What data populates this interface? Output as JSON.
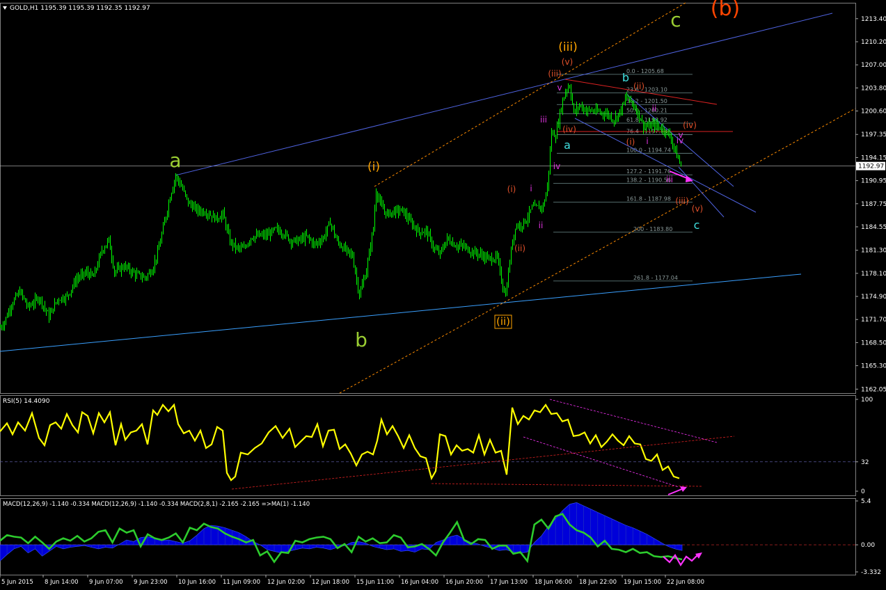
{
  "window_title": "GOLD,H1  1195.39 1195.39 1192.35 1192.97",
  "price_axis": {
    "ticks": [
      "1213.40",
      "1210.20",
      "1207.00",
      "1203.80",
      "1200.60",
      "1197.35",
      "1194.15",
      "1190.95",
      "1187.75",
      "1184.55",
      "1181.30",
      "1178.10",
      "1174.90",
      "1171.70",
      "1168.50",
      "1165.30",
      "1162.05"
    ],
    "current_price": "1192.97",
    "colors": {
      "grid": "#1a1a1a",
      "border": "#808080",
      "current": "#c0c0c0"
    }
  },
  "time_axis": {
    "ticks": [
      "5 Jun 2015",
      "8 Jun 14:00",
      "9 Jun 07:00",
      "9 Jun 23:00",
      "10 Jun 16:00",
      "11 Jun 09:00",
      "12 Jun 02:00",
      "12 Jun 18:00",
      "15 Jun 11:00",
      "16 Jun 04:00",
      "16 Jun 20:00",
      "17 Jun 13:00",
      "18 Jun 06:00",
      "18 Jun 22:00",
      "19 Jun 15:00",
      "22 Jun 08:00"
    ]
  },
  "chart_data": [
    {
      "type": "candlestick",
      "title": "GOLD,H1  1195.39 1195.39 1192.35 1192.97",
      "ylim": [
        1161.5,
        1215.6
      ],
      "candle_color": "#00ff00",
      "close_path": [
        [
          0,
          1170.6
        ],
        [
          6,
          1171.4
        ],
        [
          16,
          1173.8
        ],
        [
          28,
          1175.6
        ],
        [
          40,
          1173.4
        ],
        [
          56,
          1174.8
        ],
        [
          70,
          1172.1
        ],
        [
          82,
          1174.5
        ],
        [
          96,
          1174.9
        ],
        [
          110,
          1177.4
        ],
        [
          124,
          1178.2
        ],
        [
          134,
          1177.6
        ],
        [
          146,
          1181.3
        ],
        [
          156,
          1182.7
        ],
        [
          164,
          1178.3
        ],
        [
          178,
          1179.1
        ],
        [
          194,
          1178.0
        ],
        [
          208,
          1177.5
        ],
        [
          218,
          1178.6
        ],
        [
          226,
          1180.9
        ],
        [
          236,
          1185.2
        ],
        [
          244,
          1188.8
        ],
        [
          252,
          1191.6
        ],
        [
          260,
          1190.2
        ],
        [
          270,
          1187.9
        ],
        [
          282,
          1186.9
        ],
        [
          296,
          1186.6
        ],
        [
          310,
          1185.7
        ],
        [
          320,
          1186.3
        ],
        [
          330,
          1182.5
        ],
        [
          340,
          1181.6
        ],
        [
          350,
          1181.5
        ],
        [
          360,
          1183.1
        ],
        [
          372,
          1183.3
        ],
        [
          384,
          1183.4
        ],
        [
          396,
          1184.2
        ],
        [
          408,
          1183.6
        ],
        [
          418,
          1182.6
        ],
        [
          428,
          1182.6
        ],
        [
          440,
          1183.2
        ],
        [
          452,
          1182.1
        ],
        [
          464,
          1183.0
        ],
        [
          474,
          1185.2
        ],
        [
          484,
          1182.5
        ],
        [
          494,
          1181.5
        ],
        [
          506,
          1180.5
        ],
        [
          516,
          1175.1
        ],
        [
          526,
          1178.5
        ],
        [
          536,
          1184.4
        ],
        [
          540,
          1189.6
        ],
        [
          548,
          1187.2
        ],
        [
          556,
          1186.3
        ],
        [
          566,
          1186.7
        ],
        [
          578,
          1186.8
        ],
        [
          590,
          1185.1
        ],
        [
          602,
          1183.8
        ],
        [
          612,
          1184.0
        ],
        [
          624,
          1181.4
        ],
        [
          632,
          1180.8
        ],
        [
          642,
          1182.9
        ],
        [
          654,
          1182.0
        ],
        [
          666,
          1181.8
        ],
        [
          678,
          1181.1
        ],
        [
          690,
          1180.7
        ],
        [
          702,
          1180.1
        ],
        [
          714,
          1180.3
        ],
        [
          720,
          1177.1
        ],
        [
          726,
          1175.1
        ],
        [
          734,
          1181.3
        ],
        [
          740,
          1184.7
        ],
        [
          748,
          1184.8
        ],
        [
          756,
          1185.6
        ],
        [
          764,
          1187.2
        ],
        [
          772,
          1187.2
        ],
        [
          780,
          1187.4
        ],
        [
          786,
          1190.0
        ],
        [
          792,
          1197.6
        ],
        [
          798,
          1197.2
        ],
        [
          806,
          1201.2
        ],
        [
          812,
          1203.4
        ],
        [
          818,
          1204.2
        ],
        [
          824,
          1200.3
        ],
        [
          832,
          1201.4
        ],
        [
          842,
          1200.7
        ],
        [
          852,
          1200.6
        ],
        [
          862,
          1200.4
        ],
        [
          872,
          1200.2
        ],
        [
          882,
          1199.4
        ],
        [
          892,
          1200.8
        ],
        [
          900,
          1202.6
        ],
        [
          908,
          1201.7
        ],
        [
          916,
          1200.4
        ],
        [
          924,
          1198.6
        ],
        [
          932,
          1198.4
        ],
        [
          940,
          1198.7
        ],
        [
          948,
          1198.3
        ],
        [
          956,
          1197.9
        ],
        [
          964,
          1196.8
        ],
        [
          972,
          1194.4
        ],
        [
          978,
          1193.0
        ]
      ],
      "wave_labels": [
        {
          "text": "a",
          "color": "#9acd32"
        },
        {
          "text": "b",
          "color": "#9acd32"
        },
        {
          "text": "c",
          "color": "#9acd32"
        },
        {
          "text": "(b)",
          "color": "#ff4500"
        },
        {
          "text": "(i)",
          "color": "#ffa500"
        },
        {
          "text": "(ii)",
          "color": "#ffa500"
        },
        {
          "text": "(iii)",
          "color": "#ffa500"
        },
        {
          "text": "(i)",
          "color": "#e0502a"
        },
        {
          "text": "(ii)",
          "color": "#e0502a"
        },
        {
          "text": "(iii)",
          "color": "#e0502a"
        },
        {
          "text": "(iv)",
          "color": "#e0502a"
        },
        {
          "text": "(v)",
          "color": "#e0502a"
        },
        {
          "text": "i",
          "color": "#dd33dd"
        },
        {
          "text": "ii",
          "color": "#dd33dd"
        },
        {
          "text": "iii",
          "color": "#dd33dd"
        },
        {
          "text": "iv",
          "color": "#dd33dd"
        },
        {
          "text": "v",
          "color": "#dd33dd"
        },
        {
          "text": "a",
          "color": "#40e0e0"
        },
        {
          "text": "b",
          "color": "#40e0e0"
        },
        {
          "text": "c",
          "color": "#40e0e0"
        },
        {
          "text": "(i)",
          "color": "#e0502a"
        },
        {
          "text": "(ii)",
          "color": "#e0502a"
        },
        {
          "text": "(iii)",
          "color": "#e0502a"
        },
        {
          "text": "(iv)",
          "color": "#e0502a"
        },
        {
          "text": "(v)",
          "color": "#e0502a"
        },
        {
          "text": "i",
          "color": "#dd33dd"
        },
        {
          "text": "ii",
          "color": "#dd33dd"
        },
        {
          "text": "iii",
          "color": "#dd33dd"
        },
        {
          "text": "iv",
          "color": "#dd33dd"
        },
        {
          "text": "v",
          "color": "#dd33dd"
        }
      ],
      "fib_levels": [
        {
          "label": "0.0 - 1205.68",
          "price": 1205.68
        },
        {
          "label": "23.6 - 1203.10",
          "price": 1203.1
        },
        {
          "label": "38.2 - 1201.50",
          "price": 1201.5
        },
        {
          "label": "50.0 - 1200.21",
          "price": 1200.21
        },
        {
          "label": "61.8 - 1198.92",
          "price": 1198.92
        },
        {
          "label": "76.4 - 1197.33",
          "price": 1197.33
        },
        {
          "label": "100.0 - 1194.74",
          "price": 1194.74
        },
        {
          "label": "127.2 - 1191.76",
          "price": 1191.76
        },
        {
          "label": "138.2 - 1190.56",
          "price": 1190.56
        },
        {
          "label": "161.8 - 1187.98",
          "price": 1187.98
        },
        {
          "label": "200 - 1183.80",
          "price": 1183.8
        },
        {
          "label": "261.8 - 1177.04",
          "price": 1177.04
        }
      ],
      "fib_color": "#6c8c8c"
    },
    {
      "type": "line",
      "title": "RSI(5) 14.4090",
      "ylim": [
        0,
        100
      ],
      "ticks": [
        "100",
        "32",
        "0"
      ],
      "level": 32,
      "color": "#ffff00",
      "x": [
        0,
        10,
        18,
        26,
        36,
        46,
        56,
        64,
        72,
        80,
        88,
        96,
        104,
        112,
        118,
        126,
        134,
        142,
        150,
        158,
        166,
        174,
        180,
        188,
        196,
        204,
        212,
        220,
        226,
        234,
        242,
        250,
        256,
        264,
        272,
        280,
        288,
        296,
        304,
        312,
        320,
        326,
        332,
        338,
        346,
        356,
        366,
        376,
        386,
        396,
        406,
        416,
        424,
        432,
        440,
        448,
        456,
        464,
        472,
        480,
        488,
        496,
        504,
        512,
        520,
        528,
        536,
        542,
        548,
        556,
        564,
        572,
        580,
        588,
        596,
        604,
        612,
        620,
        626,
        632,
        640,
        648,
        656,
        664,
        672,
        680,
        688,
        696,
        704,
        712,
        720,
        728,
        736,
        744,
        752,
        760,
        768,
        776,
        784,
        792,
        800,
        808,
        816,
        824,
        832,
        840,
        848,
        856,
        864,
        872,
        880,
        888,
        896,
        904,
        912,
        920,
        928,
        936,
        944,
        952,
        960,
        968,
        976
      ],
      "y": [
        65,
        74,
        62,
        75,
        66,
        85,
        58,
        50,
        72,
        75,
        68,
        84,
        72,
        64,
        86,
        82,
        63,
        85,
        75,
        86,
        50,
        73,
        56,
        64,
        66,
        73,
        51,
        88,
        83,
        94,
        87,
        94,
        73,
        63,
        66,
        55,
        66,
        47,
        51,
        70,
        66,
        20,
        12,
        16,
        42,
        40,
        47,
        52,
        64,
        71,
        58,
        68,
        48,
        54,
        60,
        59,
        73,
        49,
        66,
        67,
        46,
        51,
        41,
        28,
        40,
        43,
        40,
        55,
        78,
        62,
        71,
        60,
        47,
        61,
        47,
        38,
        36,
        14,
        22,
        62,
        60,
        40,
        50,
        44,
        46,
        42,
        61,
        40,
        56,
        42,
        44,
        18,
        91,
        73,
        82,
        78,
        88,
        86,
        94,
        84,
        85,
        76,
        78,
        60,
        61,
        64,
        52,
        61,
        48,
        54,
        62,
        55,
        50,
        60,
        52,
        51,
        35,
        33,
        40,
        23,
        27,
        16,
        14
      ]
    },
    {
      "type": "area",
      "title": "MACD(12,26,9) -1.140 -0.334  MACD(12,26,9) -1.140 -0.334  MACD(2,8,1) -2.165 -2.165  =>MA(1) -1.140",
      "ylim": [
        -3.332,
        5.4
      ],
      "ticks": [
        "5.4",
        "0.00",
        "-3.332"
      ],
      "series": [
        {
          "values": [
            -2.0,
            -1.2,
            -0.5,
            -0.2,
            -1.0,
            -0.5,
            -1.4,
            -0.8,
            -0.2,
            -0.5,
            -0.3,
            -0.2,
            -0.1,
            -0.3,
            -0.5,
            -0.3,
            -0.4,
            0.1,
            0.6,
            0.4,
            0.9,
            1.0,
            0.8,
            0.5,
            0.6,
            0.4,
            0.2,
            0.5,
            1.2,
            2.0,
            2.4,
            2.3,
            2.1,
            1.8,
            1.5,
            1.0,
            0.4,
            0.0,
            -0.6,
            -0.8,
            -1.0,
            -0.8,
            -0.6,
            -0.4,
            -0.5,
            -0.3,
            -0.4,
            -0.6,
            -0.3,
            -0.1,
            0.3,
            0.4,
            0.2,
            -0.2,
            -0.4,
            -0.6,
            -0.5,
            -0.8,
            -0.7,
            -0.9,
            -0.5,
            -0.6,
            0.3,
            0.6,
            1.0,
            1.2,
            0.7,
            0.3,
            0.1,
            -0.2,
            -0.4,
            -0.7,
            -0.6,
            -0.9,
            -1.0,
            -0.9,
            0.3,
            1.1,
            2.3,
            3.2,
            4.2,
            5.0,
            5.2,
            4.8,
            4.4,
            4.0,
            3.6,
            3.2,
            2.8,
            2.4,
            2.1,
            1.7,
            1.3,
            0.8,
            0.3,
            -0.2,
            -0.5,
            -0.7
          ]
        },
        {
          "values": [
            0.5,
            1.2,
            1.0,
            0.9,
            0.2,
            1.0,
            0.3,
            -0.5,
            0.4,
            0.8,
            0.5,
            1.1,
            0.4,
            0.8,
            1.6,
            1.8,
            0.3,
            2.0,
            1.5,
            1.8,
            -0.2,
            1.3,
            0.8,
            0.6,
            0.9,
            1.4,
            0.3,
            2.1,
            1.8,
            2.6,
            2.2,
            2.0,
            1.4,
            1.0,
            0.7,
            0.3,
            0.6,
            -1.3,
            -0.8,
            -2.1,
            -0.9,
            -1.0,
            0.5,
            0.3,
            0.7,
            0.9,
            1.0,
            0.7,
            -0.4,
            0.1,
            -0.9,
            1.0,
            0.4,
            0.8,
            0.2,
            0.3,
            1.2,
            0.9,
            -0.3,
            -0.2,
            0.1,
            -0.5,
            -1.3,
            0.3,
            1.5,
            2.8,
            0.6,
            0.1,
            0.7,
            0.6,
            -0.5,
            -0.1,
            -0.1,
            -1.1,
            -0.9,
            -2.0,
            2.5,
            3.1,
            2.0,
            3.5,
            3.8,
            2.5,
            1.8,
            1.5,
            0.9,
            -0.2,
            0.5,
            -0.5,
            -0.6,
            -0.9,
            -0.5,
            -1.0,
            -0.9,
            -1.4,
            -1.5,
            -1.4,
            -1.6,
            -1.8
          ]
        }
      ],
      "hist_color": "#0000ff",
      "signal_color": "#2dcc2d"
    }
  ],
  "colors": {
    "background": "#000000",
    "channel": "#4f63e0",
    "channel_light": "#3aa0ff",
    "orange_dash": "#ff8c00",
    "red_line": "#dd2222",
    "magenta": "#ff33ff",
    "text": "#ffffff"
  }
}
